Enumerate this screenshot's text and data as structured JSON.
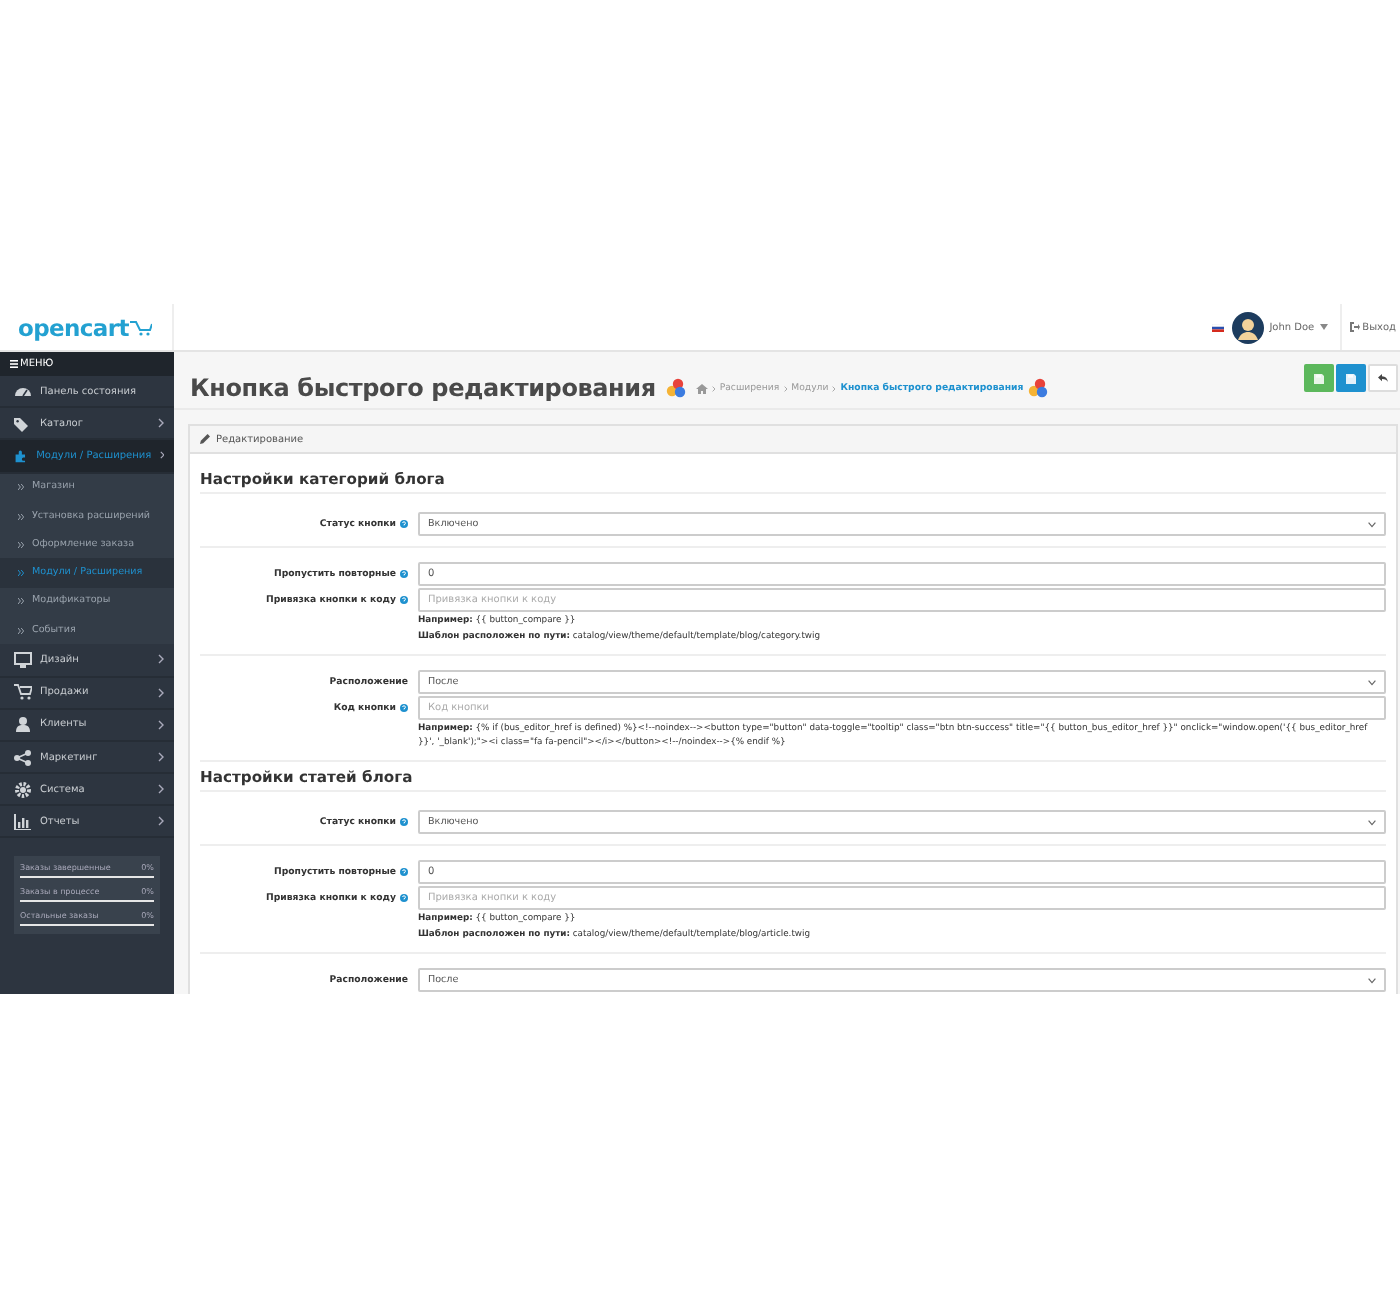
{
  "header": {
    "logo": "opencart",
    "user_name": "John Doe",
    "logout": "Выход"
  },
  "sidebar": {
    "menu_title": "МЕНЮ",
    "items": [
      {
        "label": "Панель состояния",
        "has_submenu": false,
        "selected": false
      },
      {
        "label": "Каталог",
        "has_submenu": true,
        "selected": false
      },
      {
        "label": "Модули / Расширения",
        "has_submenu": true,
        "selected": true,
        "children": [
          {
            "label": "Магазин",
            "selected": false
          },
          {
            "label": "Установка расширений",
            "selected": false
          },
          {
            "label": "Оформление заказа",
            "selected": false
          },
          {
            "label": "Модули / Расширения",
            "selected": true
          },
          {
            "label": "Модификаторы",
            "selected": false
          },
          {
            "label": "События",
            "selected": false
          }
        ]
      },
      {
        "label": "Дизайн",
        "has_submenu": true,
        "selected": false
      },
      {
        "label": "Продажи",
        "has_submenu": true,
        "selected": false
      },
      {
        "label": "Клиенты",
        "has_submenu": true,
        "selected": false
      },
      {
        "label": "Маркетинг",
        "has_submenu": true,
        "selected": false
      },
      {
        "label": "Система",
        "has_submenu": true,
        "selected": false
      },
      {
        "label": "Отчеты",
        "has_submenu": true,
        "selected": false
      }
    ],
    "stats": [
      {
        "label": "Заказы завершенные",
        "reading": "0%",
        "level": 0
      },
      {
        "label": "Заказы в процессе",
        "reading": "0%",
        "level": 0
      },
      {
        "label": "Остальные заказы",
        "reading": "0%",
        "level": 0
      }
    ]
  },
  "page": {
    "title": "Кнопка быстрого редактирования",
    "breadcrumbs": [
      {
        "label": "Расширения",
        "selected": false
      },
      {
        "label": "Модули",
        "selected": false
      },
      {
        "label": "Кнопка быстрого редактирования",
        "selected": true
      }
    ],
    "panel_title": "Редактирование",
    "sections": [
      {
        "title": "Настройки категорий блога",
        "groups": [
          {
            "fields": [
              {
                "kind": "select",
                "label": "Статус кнопки",
                "help": true,
                "value": "Включено"
              }
            ]
          },
          {
            "fields": [
              {
                "kind": "input",
                "label": "Пропустить повторные",
                "help": true,
                "value": "0"
              },
              {
                "kind": "input",
                "label": "Привязка кнопки к коду",
                "help": true,
                "placeholder": "Привязка кнопки к коду"
              }
            ],
            "notes": [
              "**Например:** {{ button_compare }}",
              "**Шаблон расположен по пути:** catalog/view/theme/default/template/blog/category.twig"
            ]
          },
          {
            "fields": [
              {
                "kind": "select",
                "label": "Расположение",
                "help": false,
                "value": "После"
              },
              {
                "kind": "input",
                "label": "Код кнопки",
                "help": true,
                "placeholder": "Код кнопки"
              }
            ],
            "notes": [
              "**Например:** {% if (bus_editor_href is defined) %}<!--noindex--><button type=\"button\" data-toggle=\"tooltip\" class=\"btn btn-success\" title=\"{{ button_bus_editor_href }}\" onclick=\"window.open('{{ bus_editor_href }}', '_blank');\"><i class=\"fa fa-pencil\"></i></button><!--/noindex-->{% endif %}"
            ]
          }
        ]
      },
      {
        "title": "Настройки статей блога",
        "groups": [
          {
            "fields": [
              {
                "kind": "select",
                "label": "Статус кнопки",
                "help": true,
                "value": "Включено"
              }
            ]
          },
          {
            "fields": [
              {
                "kind": "input",
                "label": "Пропустить повторные",
                "help": true,
                "value": "0"
              },
              {
                "kind": "input",
                "label": "Привязка кнопки к коду",
                "help": true,
                "placeholder": "Привязка кнопки к коду"
              }
            ],
            "notes": [
              "**Например:** {{ button_compare }}",
              "**Шаблон расположен по пути:** catalog/view/theme/default/template/blog/article.twig"
            ]
          },
          {
            "fields": [
              {
                "kind": "select",
                "label": "Расположение",
                "help": false,
                "value": "После"
              }
            ]
          }
        ]
      }
    ]
  }
}
